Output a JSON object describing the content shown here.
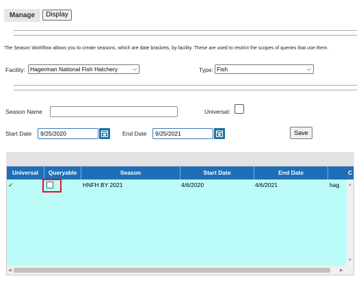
{
  "tabs": {
    "manage": "Manage",
    "display": "Display"
  },
  "description": "The Season Workflow allows you to create seasons, which are date brackets, by facility. These are used to restrict the scopes of queries that use them.",
  "filters": {
    "facility_label": "Facility:",
    "facility_value": "Hagerman National Fish Hatchery",
    "type_label": "Type:",
    "type_value": "Fish"
  },
  "form": {
    "season_name_label": "Season Name",
    "season_name_value": "",
    "universal_label": "Universal:",
    "universal_checked": false,
    "start_date_label": "Start Date",
    "start_date_value": "9/25/2020",
    "end_date_label": "End Date",
    "end_date_value": "9/25/2021",
    "save_label": "Save"
  },
  "grid": {
    "columns": [
      "Universal",
      "Queryable",
      "Season",
      "Start Date",
      "End Date",
      "C"
    ],
    "rows": [
      {
        "universal": "✓",
        "queryable": false,
        "season": "HNFH BY 2021",
        "start_date": "4/6/2020",
        "end_date": "4/6/2021",
        "extra": "hag"
      }
    ]
  },
  "colors": {
    "header_bg": "#1e6fb7",
    "row_bg": "#bcfcf8",
    "calendar_btn": "#1a6ea0",
    "highlight": "#e0141e"
  },
  "icons": [
    "calendar-icon",
    "chevron-down-icon",
    "scroll-left-icon",
    "scroll-right-icon",
    "scroll-up-icon",
    "scroll-down-icon"
  ]
}
